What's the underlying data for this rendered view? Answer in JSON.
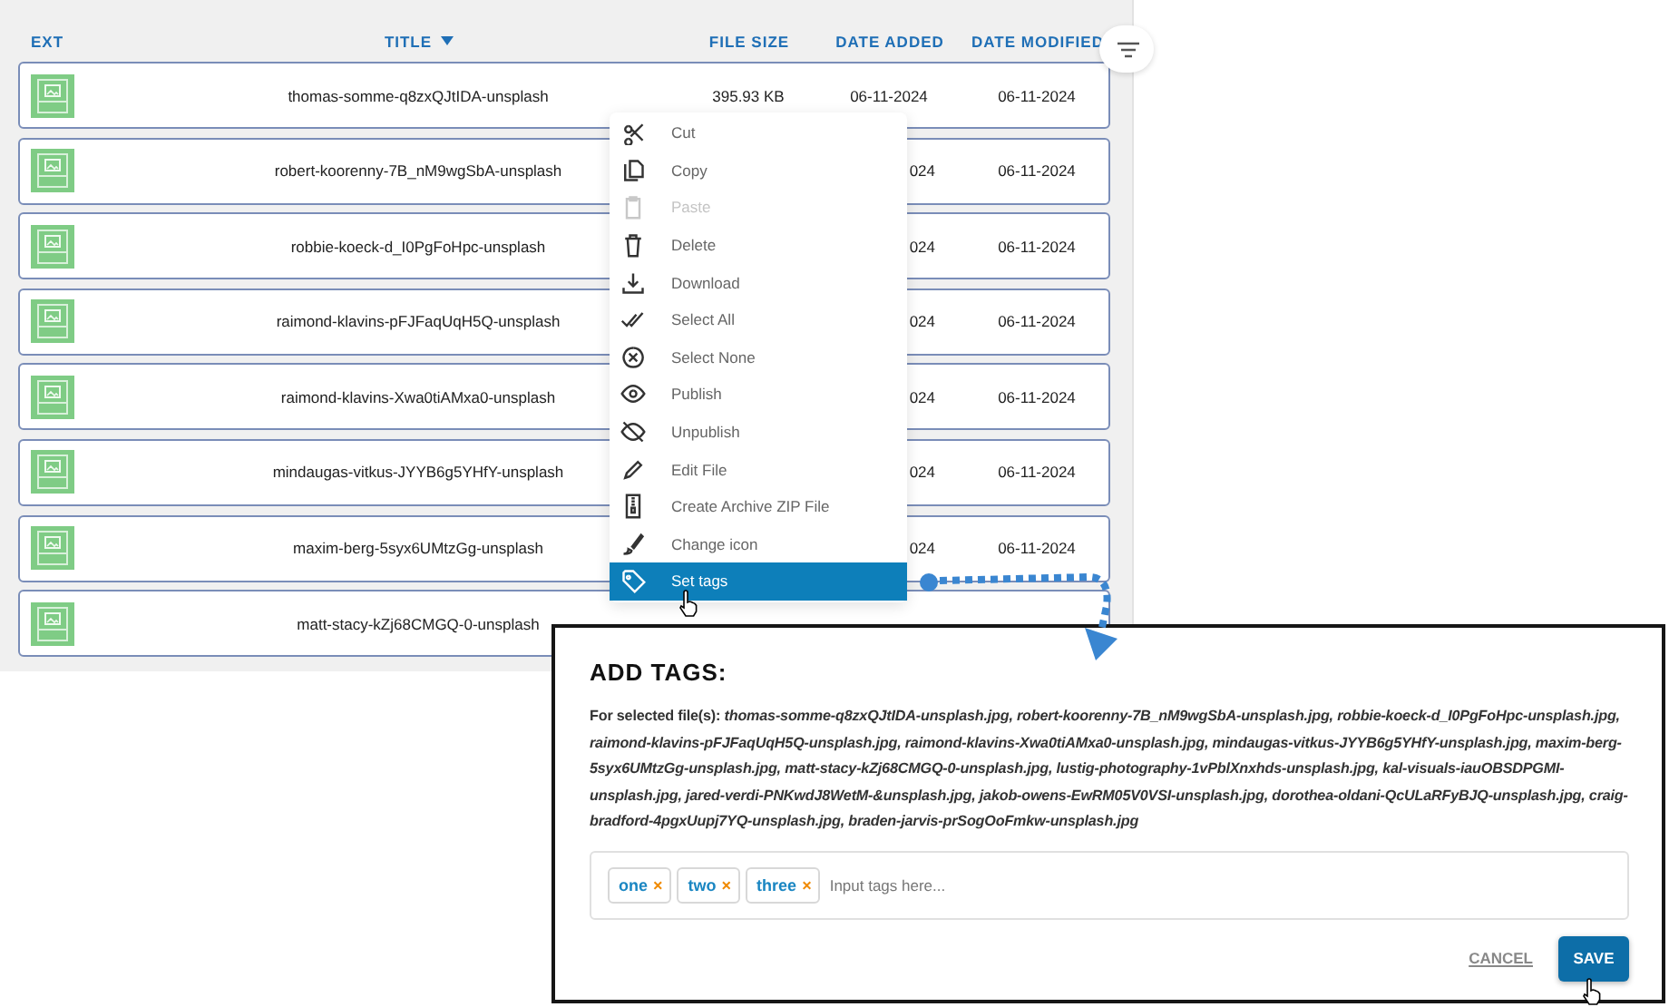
{
  "table": {
    "columns": [
      {
        "label": "EXT"
      },
      {
        "label": "TITLE",
        "sorted": true
      },
      {
        "label": "FILE SIZE"
      },
      {
        "label": "DATE ADDED"
      },
      {
        "label": "DATE MODIFIED"
      }
    ],
    "rows": [
      {
        "title": "thomas-somme-q8zxQJtIDA-unsplash",
        "file_size": "395.93 KB",
        "date_added": "06-11-2024",
        "date_modified": "06-11-2024"
      },
      {
        "title": "robert-koorenny-7B_nM9wgSbA-unsplash",
        "date_added": "024",
        "date_modified": "06-11-2024"
      },
      {
        "title": "robbie-koeck-d_I0PgFoHpc-unsplash",
        "date_added": "024",
        "date_modified": "06-11-2024"
      },
      {
        "title": "raimond-klavins-pFJFaqUqH5Q-unsplash",
        "date_added": "024",
        "date_modified": "06-11-2024"
      },
      {
        "title": "raimond-klavins-Xwa0tiAMxa0-unsplash",
        "date_added": "024",
        "date_modified": "06-11-2024"
      },
      {
        "title": "mindaugas-vitkus-JYYB6g5YHfY-unsplash",
        "date_added": "024",
        "date_modified": "06-11-2024"
      },
      {
        "title": "maxim-berg-5syx6UMtzGg-unsplash",
        "date_added": "024",
        "date_modified": "06-11-2024"
      },
      {
        "title": "matt-stacy-kZj68CMGQ-0-unsplash"
      }
    ]
  },
  "context_menu": {
    "items": [
      {
        "label": "Cut",
        "disabled": false,
        "selected": false
      },
      {
        "label": "Copy",
        "disabled": false,
        "selected": false
      },
      {
        "label": "Paste",
        "disabled": true,
        "selected": false
      },
      {
        "label": "Delete",
        "disabled": false,
        "selected": false
      },
      {
        "label": "Download",
        "disabled": false,
        "selected": false
      },
      {
        "label": "Select All",
        "disabled": false,
        "selected": false
      },
      {
        "label": "Select None",
        "disabled": false,
        "selected": false
      },
      {
        "label": "Publish",
        "disabled": false,
        "selected": false
      },
      {
        "label": "Unpublish",
        "disabled": false,
        "selected": false
      },
      {
        "label": "Edit File",
        "disabled": false,
        "selected": false
      },
      {
        "label": "Create Archive ZIP File",
        "disabled": false,
        "selected": false
      },
      {
        "label": "Change icon",
        "disabled": false,
        "selected": false
      },
      {
        "label": "Set tags",
        "disabled": false,
        "selected": true
      }
    ]
  },
  "dialog": {
    "title": "ADD TAGS:",
    "files_text": "For selected file(s): *thomas-somme-q8zxQJtIDA-unsplash.jpg, robert-koorenny-7B_nM9wgSbA-unsplash.jpg, robbie-koeck-d_I0PgFoHpc-unsplash.jpg, raimond-klavins-pFJFaqUqH5Q-unsplash.jpg, raimond-klavins-Xwa0tiAMxa0-unsplash.jpg, mindaugas-vitkus-JYYB6g5YHfY-unsplash.jpg, maxim-berg-5syx6UMtzGg-unsplash.jpg, matt-stacy-kZj68CMGQ-0-unsplash.jpg, lustig-photography-1vPblXnxhds-unsplash.jpg, kal-visuals-iauOBSDPGMI-unsplash.jpg, jared-verdi-PNKwdJ8WetM-&unsplash.jpg, jakob-owens-EwRM05V0VSI-unsplash.jpg, dorothea-oldani-QcULaRFyBJQ-unsplash.jpg, craig-bradford-4pgxUupj7YQ-unsplash.jpg, braden-jarvis-prSogOoFmkw-unsplash.jpg*",
    "tags": [
      {
        "label": "one",
        "remove": "×"
      },
      {
        "label": "two",
        "remove": "×"
      },
      {
        "label": "three",
        "remove": "×"
      }
    ],
    "tag_input": {
      "placeholder": "Input tags here..."
    },
    "buttons": [
      {
        "label": "CANCEL",
        "kind": "link"
      },
      {
        "label": "SAVE",
        "kind": "primary"
      }
    ]
  }
}
